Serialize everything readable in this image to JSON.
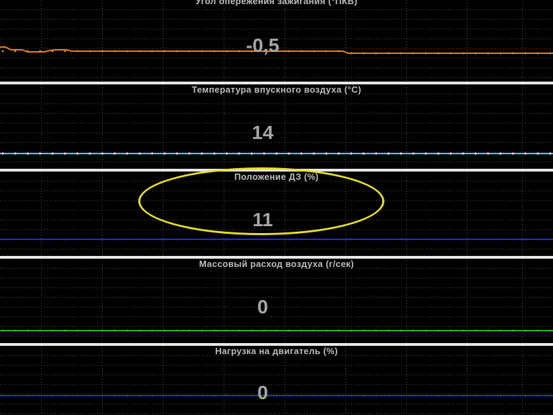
{
  "panels": [
    {
      "id": "ignition",
      "title": "Угол опережения зажигания  (°ПКВ)",
      "value": "-0,5",
      "color": "#e0812c"
    },
    {
      "id": "intake-temp",
      "title": "Температура впускного воздуха  (°C)",
      "value": "14",
      "color": "#3fd3e6"
    },
    {
      "id": "throttle",
      "title": "Положение ДЗ  (%)",
      "value": "11",
      "color": "#1f2bd9"
    },
    {
      "id": "mass-airflow",
      "title": "Массовый расход воздуха  (г/сек)",
      "value": "0",
      "color": "#1fb81f"
    },
    {
      "id": "engine-load",
      "title": "Нагрузка на двигатель  (%)",
      "value": "0",
      "color": "#1f2bd9"
    }
  ],
  "highlight": {
    "color": "#e8e02a",
    "target": "throttle"
  }
}
